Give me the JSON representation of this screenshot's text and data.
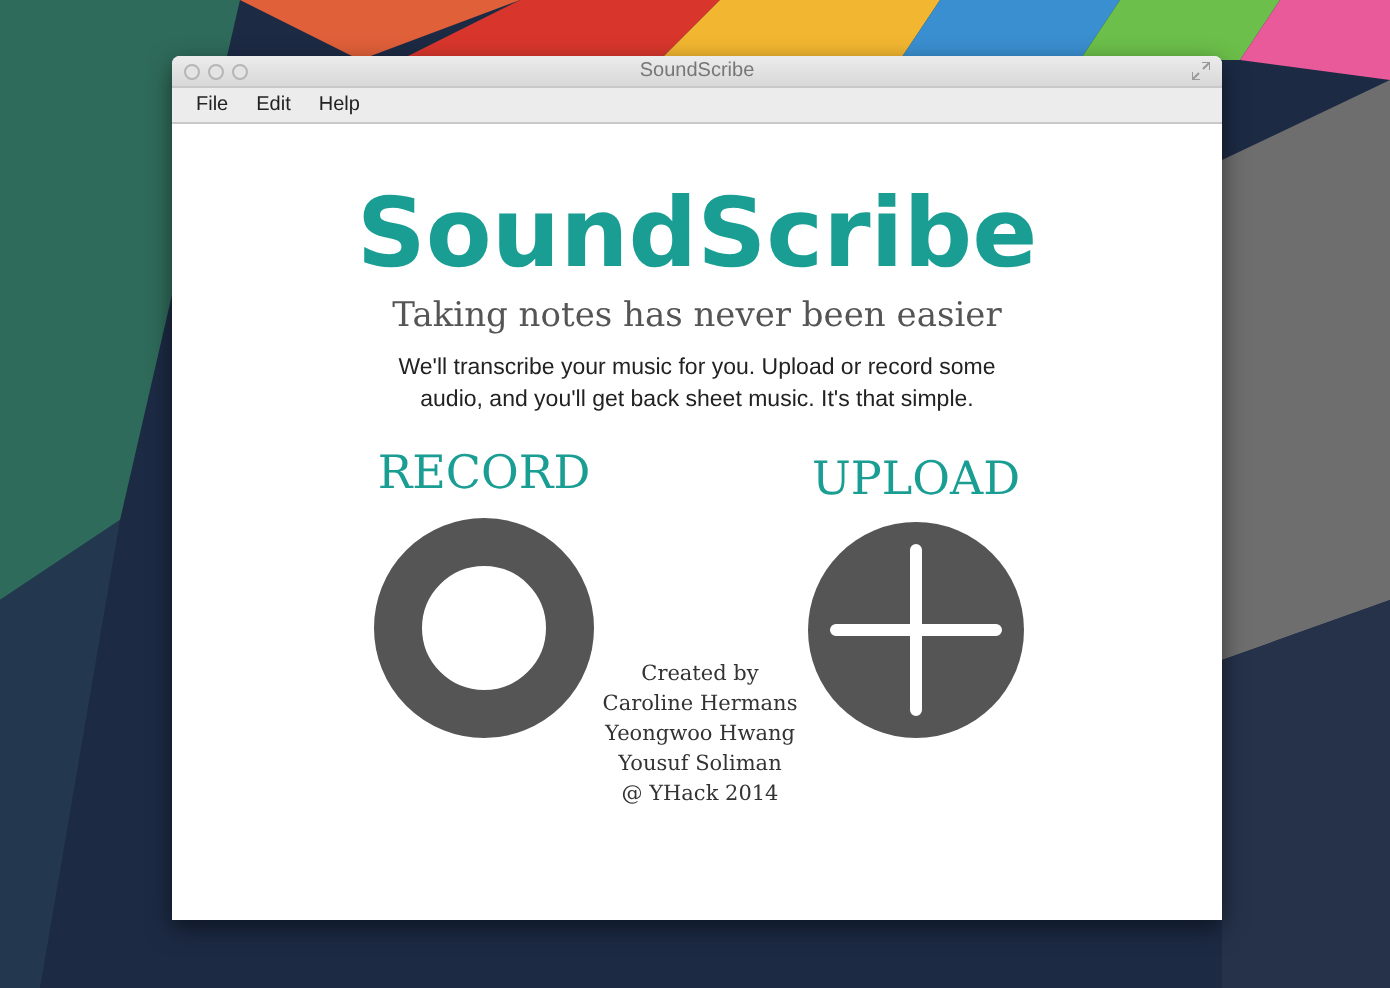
{
  "window": {
    "title": "SoundScribe"
  },
  "menu": [
    "File",
    "Edit",
    "Help"
  ],
  "app_title": "SoundScribe",
  "tagline": "Taking notes has never been easier",
  "description": "We'll transcribe your music for you. Upload or record some audio, and you'll get back sheet music. It's that simple.",
  "actions": [
    {
      "label": "RECORD",
      "kind": "record"
    },
    {
      "label": "UPLOAD",
      "kind": "upload"
    }
  ],
  "credits": [
    "Created by",
    "Caroline Hermans",
    "Yeongwoo Hwang",
    "Yousuf Soliman",
    "@ YHack 2014"
  ]
}
